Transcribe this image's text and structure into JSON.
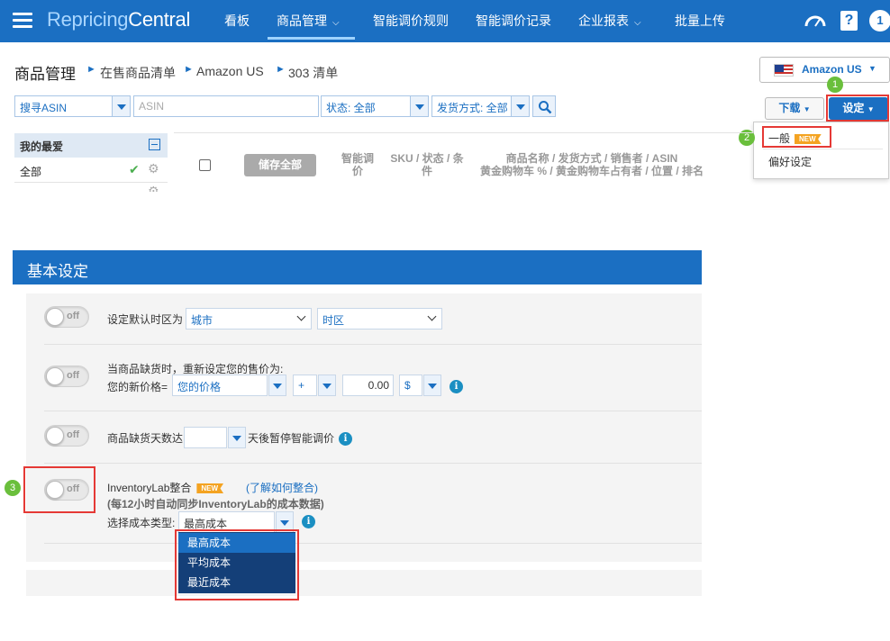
{
  "nav": {
    "logo_part1": "Repricing",
    "logo_part2": "Central",
    "items": [
      {
        "label": "看板"
      },
      {
        "label": "商品管理"
      },
      {
        "label": "智能调价规则"
      },
      {
        "label": "智能调价记录"
      },
      {
        "label": "企业报表"
      },
      {
        "label": "批量上传"
      }
    ],
    "help_glyph": "?",
    "notification_count": "1"
  },
  "breadcrumb": {
    "title": "商品管理",
    "items": [
      "在售商品清单",
      "Amazon US",
      "303 清单"
    ]
  },
  "store_selector": {
    "label": "Amazon US"
  },
  "filters": {
    "search_field": "搜寻ASIN",
    "search_placeholder": "ASIN",
    "status": "状态: 全部",
    "fulfillment": "发货方式: 全部"
  },
  "toolbar": {
    "download_label": "下载",
    "settings_label": "设定"
  },
  "settings_menu": {
    "general_label": "一般",
    "new_badge": "NEW",
    "preferences_label": "偏好设定"
  },
  "favorites": {
    "header": "我的最爱",
    "items": [
      {
        "label": "全部"
      }
    ]
  },
  "table": {
    "save_all_label": "储存全部",
    "col_smart_line1": "智能调",
    "col_smart_line2": "价",
    "col_sku_line1": "SKU / 状态 / 条",
    "col_sku_line2": "件",
    "col_name_line1": "商品名称 / 发货方式 / 销售者 / ASIN",
    "col_name_line2": "黄金购物车 % / 黄金购物车占有者 / 位置 / 排名"
  },
  "steps": [
    "1",
    "2",
    "3"
  ],
  "basic_settings": {
    "title": "基本设定",
    "toggle_off_label": "off",
    "timezone": {
      "label": "设定默认时区为",
      "city_value": "城市",
      "zone_value": "时区"
    },
    "out_of_stock_price": {
      "line1": "当商品缺货时，重新设定您的售价为:",
      "new_price_label": "您的新价格=",
      "price_basis": "您的价格",
      "operator": "+",
      "amount": "0.00",
      "unit": "$"
    },
    "pause_days": {
      "prefix": "商品缺货天数达",
      "value": "",
      "suffix": "天後暂停智能调价"
    },
    "inventorylab": {
      "title": "InventoryLab整合",
      "new_badge": "NEW",
      "learn_link": "(了解如何整合)",
      "note": "(每12小时自动同步InventoryLab的成本数据)",
      "cost_type_label": "选择成本类型:",
      "cost_type_value": "最高成本",
      "cost_options": [
        "最高成本",
        "平均成本",
        "最近成本"
      ]
    }
  },
  "colors": {
    "brand_blue": "#1b6fc2",
    "highlight_red": "#e53935",
    "step_green": "#6abf3c",
    "badge_orange": "#f4a321"
  }
}
